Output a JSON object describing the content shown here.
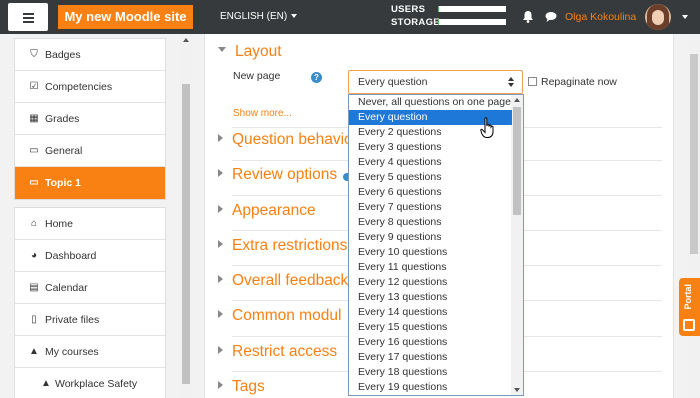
{
  "navbar": {
    "site_name": "My new Moodle site",
    "language": "ENGLISH (EN)",
    "quota_users_label": "USERS",
    "quota_storage_label": "STORAGE",
    "quota_users_fill": 0.02,
    "quota_storage_fill": 0.02,
    "user_name": "Olga Kokoulina"
  },
  "drawer": {
    "course_items": [
      {
        "label": "Badges",
        "icon": "shield-icon"
      },
      {
        "label": "Competencies",
        "icon": "checkbox-icon"
      },
      {
        "label": "Grades",
        "icon": "table-icon"
      },
      {
        "label": "General",
        "icon": "folder-icon"
      },
      {
        "label": "Topic 1",
        "icon": "folder-icon",
        "active": true
      }
    ],
    "site_items": [
      {
        "label": "Home",
        "icon": "home-icon"
      },
      {
        "label": "Dashboard",
        "icon": "dashboard-icon"
      },
      {
        "label": "Calendar",
        "icon": "calendar-icon"
      },
      {
        "label": "Private files",
        "icon": "file-icon"
      },
      {
        "label": "My courses",
        "icon": "graduation-cap-icon"
      },
      {
        "label": "Workplace Safety",
        "icon": "graduation-cap-icon"
      }
    ]
  },
  "form": {
    "layout_section": "Layout",
    "new_page_label": "New page",
    "new_page_value": "Every question",
    "repaginate_label": "Repaginate now",
    "show_more": "Show more...",
    "sections": [
      "Question behavio",
      "Review options",
      "Appearance",
      "Extra restrictions",
      "Overall feedback",
      "Common modul",
      "Restrict access",
      "Tags"
    ]
  },
  "dropdown": {
    "options": [
      "Never, all questions on one page",
      "Every question",
      "Every 2 questions",
      "Every 3 questions",
      "Every 4 questions",
      "Every 5 questions",
      "Every 6 questions",
      "Every 7 questions",
      "Every 8 questions",
      "Every 9 questions",
      "Every 10 questions",
      "Every 11 questions",
      "Every 12 questions",
      "Every 13 questions",
      "Every 14 questions",
      "Every 15 questions",
      "Every 16 questions",
      "Every 17 questions",
      "Every 18 questions",
      "Every 19 questions"
    ],
    "selected_index": 1
  },
  "portal": {
    "label": "Portal"
  },
  "colors": {
    "accent": "#f98012",
    "navbar": "#373a3c",
    "selection": "#1e78d7"
  }
}
